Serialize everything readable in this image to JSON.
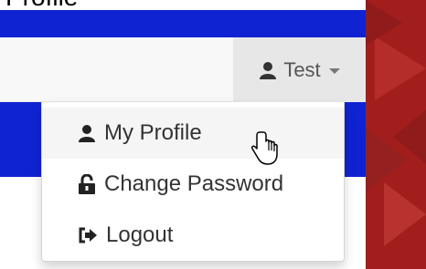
{
  "caption": "Profile",
  "navbar": {
    "user_menu_label": "Test"
  },
  "dropdown": {
    "items": [
      {
        "label": "My Profile",
        "icon": "user-icon"
      },
      {
        "label": "Change Password",
        "icon": "unlock-icon"
      },
      {
        "label": "Logout",
        "icon": "sign-out-icon"
      }
    ]
  },
  "colors": {
    "brand_blue": "#1023d2",
    "side_red": "#a21e1c",
    "navbar_bg": "#f8f8f8",
    "toggle_bg": "#e7e7e7",
    "menu_hover": "#f5f5f5",
    "text_dark": "#333333"
  }
}
